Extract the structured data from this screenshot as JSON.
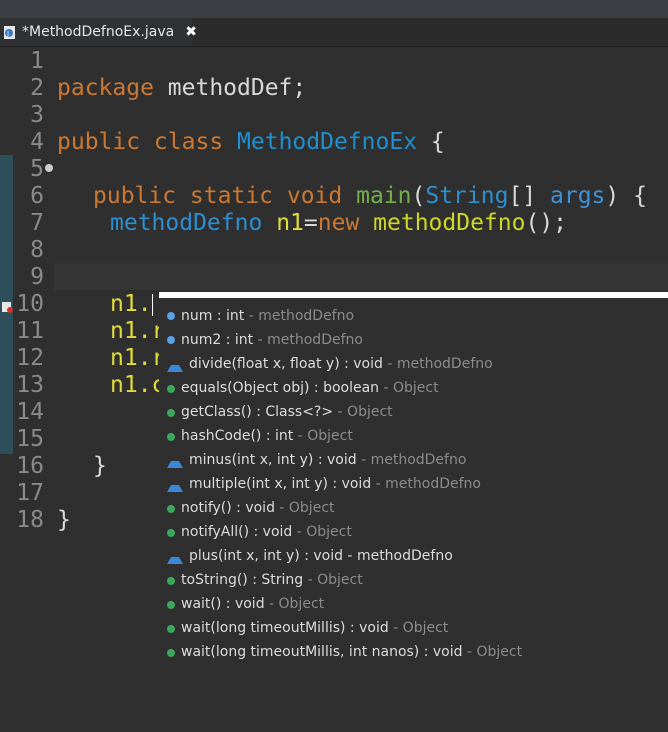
{
  "tab": {
    "label": "*MethodDefnoEx.java",
    "close": "✖"
  },
  "lines": [
    {
      "n": "1"
    },
    {
      "n": "2"
    },
    {
      "n": "3"
    },
    {
      "n": "4"
    },
    {
      "n": "5"
    },
    {
      "n": "6"
    },
    {
      "n": "7"
    },
    {
      "n": "8"
    },
    {
      "n": "9"
    },
    {
      "n": "10"
    },
    {
      "n": "11"
    },
    {
      "n": "12"
    },
    {
      "n": "13"
    },
    {
      "n": "14"
    },
    {
      "n": "15"
    },
    {
      "n": "16"
    },
    {
      "n": "17"
    },
    {
      "n": "18"
    }
  ],
  "code": {
    "l1_kw": "package",
    "l1_rest": " methodDef;",
    "l3_kw": "public class",
    "l3_cls": "MethodDefnoEx",
    "l3_brace": " {",
    "l5_kw": "public static void",
    "l5_m": "main",
    "l5_p1": "(",
    "l5_type": "String",
    "l5_p2": "[] ",
    "l5_args": "args",
    "l5_p3": ") {",
    "l6_type": "methodDefno",
    "l6_var": "n1",
    "l6_eq": "=",
    "l6_new": "new",
    "l6_ctor": "methodDefno",
    "l6_end": "();",
    "l9": "n1.",
    "l10": "n1.r",
    "l11": "n1.r",
    "l12": "n1.c",
    "l15": "}",
    "l17": "}"
  },
  "completion": {
    "items": [
      {
        "icon": "field",
        "sig": "num : int",
        "owner": " - methodDefno"
      },
      {
        "icon": "field",
        "sig": "num2 : int",
        "owner": " - methodDefno"
      },
      {
        "icon": "method-default",
        "sig": "divide(float x, float y) : void",
        "owner": " - methodDefno"
      },
      {
        "icon": "method-public",
        "sig": "equals(Object obj) : boolean",
        "owner": " - Object"
      },
      {
        "icon": "method-public",
        "sig": "getClass() : Class<?>",
        "owner": " - Object"
      },
      {
        "icon": "method-public",
        "sig": "hashCode() : int",
        "owner": " - Object"
      },
      {
        "icon": "method-default",
        "sig": "minus(int x, int y) : void",
        "owner": " - methodDefno"
      },
      {
        "icon": "method-default",
        "sig": "multiple(int x, int y) : void",
        "owner": " - methodDefno"
      },
      {
        "icon": "method-public",
        "sig": "notify() : void",
        "owner": " - Object"
      },
      {
        "icon": "method-public",
        "sig": "notifyAll() : void",
        "owner": " - Object"
      },
      {
        "icon": "method-default",
        "sig": "plus(int x, int y) : void - methodDefno",
        "owner": ""
      },
      {
        "icon": "method-public",
        "sig": "toString() : String",
        "owner": " - Object"
      },
      {
        "icon": "method-public",
        "sig": "wait() : void",
        "owner": " - Object"
      },
      {
        "icon": "method-public",
        "sig": "wait(long timeoutMillis) : void",
        "owner": " - Object"
      },
      {
        "icon": "method-public",
        "sig": "wait(long timeoutMillis, int nanos) : void",
        "owner": " - Object"
      }
    ]
  }
}
